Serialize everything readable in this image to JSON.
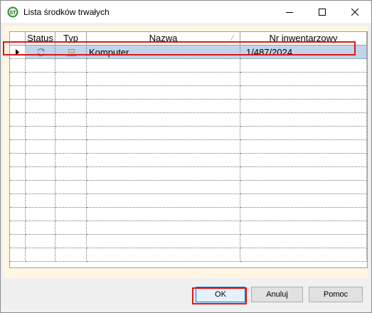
{
  "window": {
    "title": "Lista środków trwałych",
    "icon": "app-st-icon",
    "controls": [
      "minimize-icon",
      "maximize-icon",
      "close-icon"
    ]
  },
  "table": {
    "columns": [
      "Status",
      "Typ",
      "Nazwa",
      "Nr inwentarzowy"
    ],
    "rows": [
      {
        "selected": true,
        "status_icon": "refresh-icon",
        "type_icon": "computer-icon",
        "nazwa": "Komputer",
        "nr_inwentarzowy": "1/487/2024"
      }
    ],
    "row_indicator_icon": "row-pointer-icon"
  },
  "buttons": {
    "ok": "OK",
    "cancel": "Anuluj",
    "help": "Pomoc"
  },
  "colors": {
    "selection": "#bfd5ea",
    "highlight_outline": "#e0171b",
    "dialog_bg": "#f0f0f0",
    "frame_bg": "#fff6e3"
  }
}
